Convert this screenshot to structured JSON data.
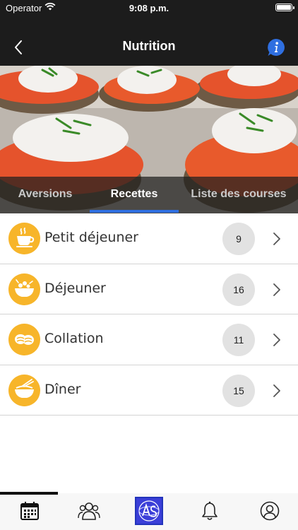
{
  "status_bar": {
    "carrier": "Operator",
    "time": "9:08 p.m."
  },
  "nav": {
    "title": "Nutrition",
    "back_icon": "chevron-left-icon",
    "info_icon": "info-icon",
    "info_color": "#2f6fe0"
  },
  "tabs": [
    {
      "label": "Aversions",
      "active": false
    },
    {
      "label": "Recettes",
      "active": true
    },
    {
      "label": "Liste des courses",
      "active": false
    }
  ],
  "accent_color": "#2f6fe0",
  "categories": [
    {
      "label": "Petit déjeuner",
      "count": "9",
      "icon": "coffee-cup-icon"
    },
    {
      "label": "Déjeuner",
      "count": "16",
      "icon": "salad-bowl-icon"
    },
    {
      "label": "Collation",
      "count": "11",
      "icon": "cookies-icon"
    },
    {
      "label": "Dîner",
      "count": "15",
      "icon": "rice-bowl-icon"
    }
  ],
  "icon_color": "#f7b52a",
  "bottom_tabs": [
    {
      "name": "calendar-icon",
      "selected": true
    },
    {
      "name": "community-icon",
      "selected": false
    },
    {
      "name": "app-logo-icon",
      "selected": false
    },
    {
      "name": "bell-icon",
      "selected": false
    },
    {
      "name": "profile-icon",
      "selected": false
    }
  ]
}
